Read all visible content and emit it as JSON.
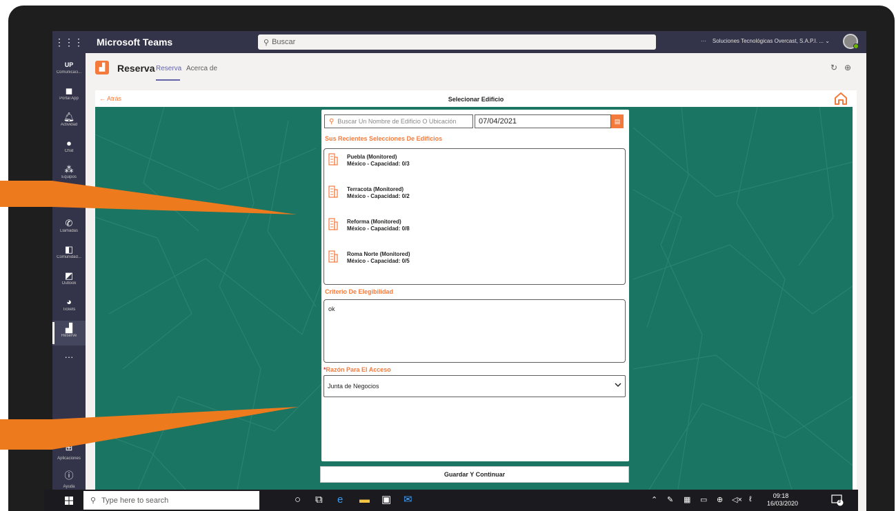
{
  "teams": {
    "app_title": "Microsoft Teams",
    "search_placeholder": "Buscar",
    "org_name": "Soluciones Tecnológicas Overcast, S.A.P.I. ...",
    "more": "···"
  },
  "rail": {
    "items": [
      {
        "icon": "UP",
        "label": "Comunicaci..."
      },
      {
        "icon": "portal-icon",
        "label": "Portal App"
      },
      {
        "icon": "bell-icon",
        "label": "Actividad"
      },
      {
        "icon": "chat-icon",
        "label": "Chat"
      },
      {
        "icon": "teams-icon",
        "label": "Equipos"
      },
      {
        "icon": "phone-icon",
        "label": "Llamadas"
      },
      {
        "icon": "community-icon",
        "label": "Comunidad..."
      },
      {
        "icon": "outlook-icon",
        "label": "Outlook"
      },
      {
        "icon": "tickets-icon",
        "label": "Tickets"
      },
      {
        "icon": "reserve-icon",
        "label": "Reserve"
      }
    ],
    "more": "···",
    "apps_label": "Aplicaciones",
    "help_label": "Ayuda"
  },
  "app_header": {
    "name": "Reserva",
    "tabs": [
      "Reserva",
      "Acerca de"
    ],
    "active_tab": 0
  },
  "subbar": {
    "back": "← Atrás",
    "title": "Selecionar Edificio"
  },
  "form": {
    "building_search_placeholder": "Buscar Un Nombre de Edificio O Ubicación",
    "date": "07/04/2021",
    "recent_label": "Sus Recientes Selecciones De Edificios",
    "buildings": [
      {
        "name": "Puebla (Monitored)",
        "detail": "México - Capacidad: 0/3"
      },
      {
        "name": "Terracota (Monitored)",
        "detail": "México - Capacidad: 0/2"
      },
      {
        "name": "Reforma (Monitored)",
        "detail": "México - Capacidad: 0/8"
      },
      {
        "name": "Roma Norte (Monitored)",
        "detail": "México - Capacidad: 0/5"
      }
    ],
    "criteria_label": "Criterio De Elegibilidad",
    "criteria_value": "ok",
    "reason_required": "*",
    "reason_label": "Razón Para El Acceso",
    "reason_value": "Junta de Negocios",
    "save_label": "Guardar Y Continuar"
  },
  "taskbar": {
    "search_placeholder": "Type here to search",
    "time": "09:18",
    "date": "16/03/2020",
    "notification_count": "3"
  },
  "colors": {
    "teams_purple": "#33344a",
    "accent_orange": "#f47a3c",
    "map_green": "#1a7563",
    "tab_accent": "#6264a7"
  }
}
